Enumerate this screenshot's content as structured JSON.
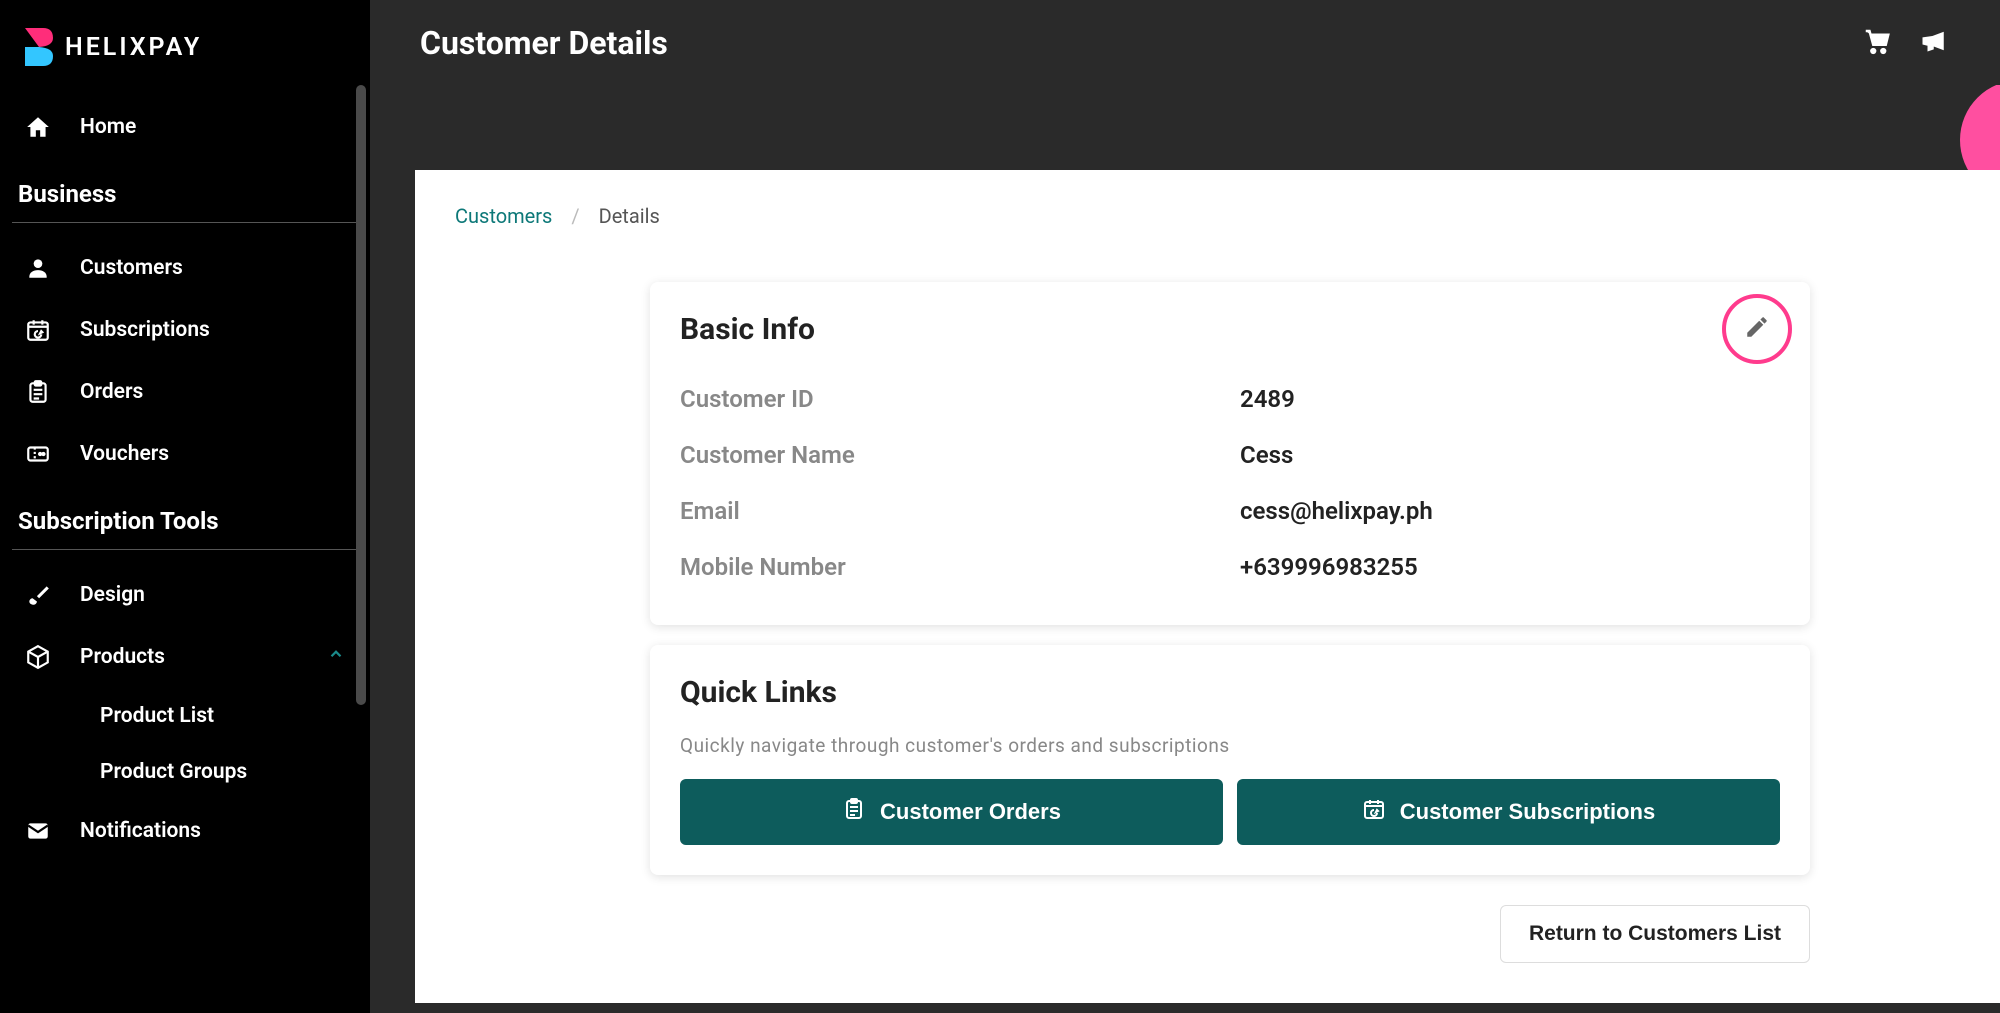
{
  "brand": {
    "name": "HELIXPAY"
  },
  "header": {
    "title": "Customer Details"
  },
  "breadcrumb": {
    "parent": "Customers",
    "current": "Details"
  },
  "sidebar": {
    "home": "Home",
    "section1": "Business",
    "items1": [
      {
        "label": "Customers"
      },
      {
        "label": "Subscriptions"
      },
      {
        "label": "Orders"
      },
      {
        "label": "Vouchers"
      }
    ],
    "section2": "Subscription Tools",
    "items2": [
      {
        "label": "Design"
      },
      {
        "label": "Products",
        "expanded": true,
        "children": [
          {
            "label": "Product List"
          },
          {
            "label": "Product Groups"
          }
        ]
      },
      {
        "label": "Notifications"
      }
    ]
  },
  "basic_info": {
    "title": "Basic Info",
    "fields": {
      "id_label": "Customer ID",
      "id_value": "2489",
      "name_label": "Customer Name",
      "name_value": "Cess",
      "email_label": "Email",
      "email_value": "cess@helixpay.ph",
      "mobile_label": "Mobile Number",
      "mobile_value": "+639996983255"
    }
  },
  "quick_links": {
    "title": "Quick Links",
    "subtitle": "Quickly navigate through customer's orders and subscriptions",
    "orders_btn": "Customer Orders",
    "subs_btn": "Customer Subscriptions"
  },
  "return_btn": "Return to Customers List"
}
